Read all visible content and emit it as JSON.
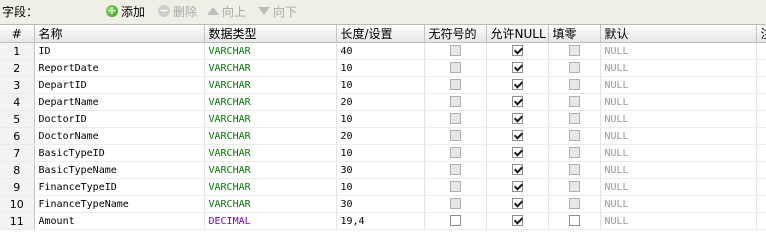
{
  "toolbar": {
    "label": "字段：",
    "add": "添加",
    "delete": "删除",
    "move_up": "向上",
    "move_down": "向下"
  },
  "columns": [
    "#",
    "名称",
    "数据类型",
    "长度/设置",
    "无符号的",
    "允许NULL",
    "填零",
    "默认",
    "注"
  ],
  "rows": [
    {
      "num": "1",
      "name": "ID",
      "type": "VARCHAR",
      "length": "40",
      "unsigned": false,
      "unsigned_enabled": false,
      "allow_null": true,
      "zerofill": false,
      "zerofill_enabled": false,
      "default": "NULL"
    },
    {
      "num": "2",
      "name": "ReportDate",
      "type": "VARCHAR",
      "length": "10",
      "unsigned": false,
      "unsigned_enabled": false,
      "allow_null": true,
      "zerofill": false,
      "zerofill_enabled": false,
      "default": "NULL"
    },
    {
      "num": "3",
      "name": "DepartID",
      "type": "VARCHAR",
      "length": "10",
      "unsigned": false,
      "unsigned_enabled": false,
      "allow_null": true,
      "zerofill": false,
      "zerofill_enabled": false,
      "default": "NULL"
    },
    {
      "num": "4",
      "name": "DepartName",
      "type": "VARCHAR",
      "length": "20",
      "unsigned": false,
      "unsigned_enabled": false,
      "allow_null": true,
      "zerofill": false,
      "zerofill_enabled": false,
      "default": "NULL"
    },
    {
      "num": "5",
      "name": "DoctorID",
      "type": "VARCHAR",
      "length": "10",
      "unsigned": false,
      "unsigned_enabled": false,
      "allow_null": true,
      "zerofill": false,
      "zerofill_enabled": false,
      "default": "NULL"
    },
    {
      "num": "6",
      "name": "DoctorName",
      "type": "VARCHAR",
      "length": "20",
      "unsigned": false,
      "unsigned_enabled": false,
      "allow_null": true,
      "zerofill": false,
      "zerofill_enabled": false,
      "default": "NULL"
    },
    {
      "num": "7",
      "name": "BasicTypeID",
      "type": "VARCHAR",
      "length": "10",
      "unsigned": false,
      "unsigned_enabled": false,
      "allow_null": true,
      "zerofill": false,
      "zerofill_enabled": false,
      "default": "NULL"
    },
    {
      "num": "8",
      "name": "BasicTypeName",
      "type": "VARCHAR",
      "length": "30",
      "unsigned": false,
      "unsigned_enabled": false,
      "allow_null": true,
      "zerofill": false,
      "zerofill_enabled": false,
      "default": "NULL"
    },
    {
      "num": "9",
      "name": "FinanceTypeID",
      "type": "VARCHAR",
      "length": "10",
      "unsigned": false,
      "unsigned_enabled": false,
      "allow_null": true,
      "zerofill": false,
      "zerofill_enabled": false,
      "default": "NULL"
    },
    {
      "num": "10",
      "name": "FinanceTypeName",
      "type": "VARCHAR",
      "length": "30",
      "unsigned": false,
      "unsigned_enabled": false,
      "allow_null": true,
      "zerofill": false,
      "zerofill_enabled": false,
      "default": "NULL"
    },
    {
      "num": "11",
      "name": "Amount",
      "type": "DECIMAL",
      "length": "19,4",
      "unsigned": false,
      "unsigned_enabled": true,
      "allow_null": true,
      "zerofill": false,
      "zerofill_enabled": true,
      "default": "NULL"
    }
  ],
  "colors": {
    "varchar": "#007a00",
    "decimal": "#7f00c8",
    "default_text": "#9a9a9a"
  }
}
